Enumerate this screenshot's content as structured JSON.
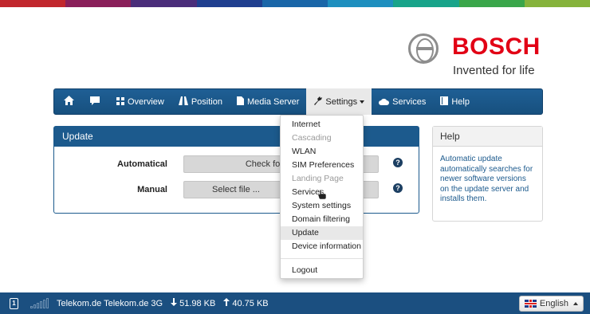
{
  "top_band_colors": [
    "#c1272d",
    "#8a1f5a",
    "#4a2d7a",
    "#1f3f8f",
    "#1a66a8",
    "#1e8fbf",
    "#18a48a",
    "#3aa64a",
    "#86b33c"
  ],
  "logo": {
    "brand": "BOSCH",
    "tagline": "Invented for life",
    "brand_color": "#e20015"
  },
  "navbar": {
    "items": [
      {
        "icon": "home-icon",
        "label": ""
      },
      {
        "icon": "chat-icon",
        "label": ""
      },
      {
        "icon": "grid-icon",
        "label": "Overview"
      },
      {
        "icon": "road-icon",
        "label": "Position"
      },
      {
        "icon": "file-icon",
        "label": "Media Server"
      },
      {
        "icon": "wrench-icon",
        "label": "Settings"
      },
      {
        "icon": "cloud-icon",
        "label": "Services"
      },
      {
        "icon": "book-icon",
        "label": "Help"
      }
    ]
  },
  "update_panel": {
    "title": "Update",
    "rows": [
      {
        "label": "Automatical",
        "button": "Check for updates"
      },
      {
        "label": "Manual",
        "button": "Select file ..."
      }
    ]
  },
  "help_panel": {
    "title": "Help",
    "text": "Automatic update automatically searches for newer software versions on the update server and installs them."
  },
  "settings_menu": {
    "items": [
      {
        "label": "Internet",
        "disabled": false
      },
      {
        "label": "Cascading",
        "disabled": true
      },
      {
        "label": "WLAN",
        "disabled": false
      },
      {
        "label": "SIM Preferences",
        "disabled": false
      },
      {
        "label": "Landing Page",
        "disabled": true
      },
      {
        "label": "Services",
        "disabled": false
      },
      {
        "label": "System settings",
        "disabled": false
      },
      {
        "label": "Domain filtering",
        "disabled": false
      },
      {
        "label": "Update",
        "disabled": false,
        "highlighted": true
      },
      {
        "label": "Device information",
        "disabled": false
      }
    ],
    "logout": "Logout"
  },
  "footer": {
    "sim_slot": "1",
    "network": "Telekom.de Telekom.de 3G",
    "download": "51.98 KB",
    "upload": "40.75 KB",
    "language": "English"
  }
}
